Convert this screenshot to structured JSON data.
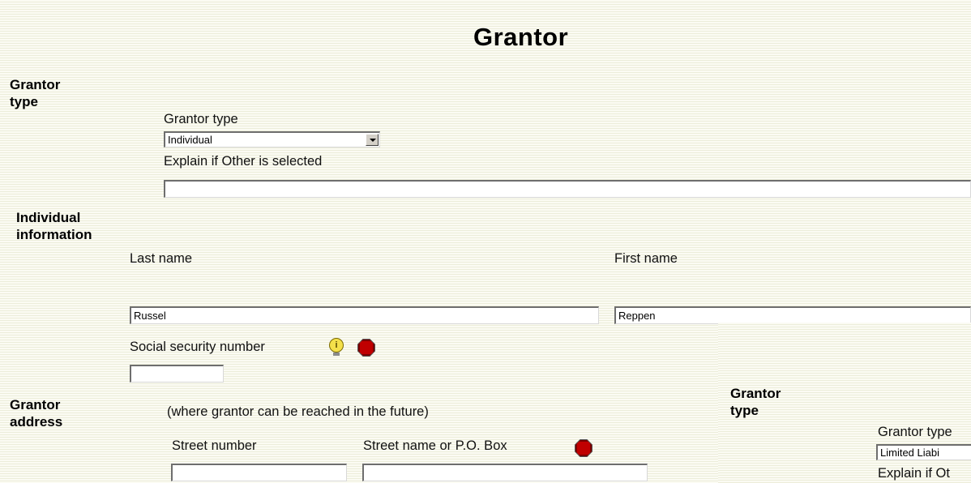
{
  "page": {
    "title": "Grantor"
  },
  "grantor_type_section": {
    "heading_line1": "Grantor",
    "heading_line2": "type",
    "type_label": "Grantor type",
    "type_value": "Individual",
    "explain_label": "Explain if Other is selected",
    "explain_value": ""
  },
  "individual_section": {
    "heading_line1": "Individual",
    "heading_line2": "information",
    "last_name_label": "Last name",
    "last_name_value": "Russel",
    "first_name_label": "First name",
    "first_name_value": "Reppen",
    "ssn_label": "Social security number",
    "ssn_value": "",
    "info_icon": "lightbulb-info-icon",
    "required_icon": "stop-sign-icon"
  },
  "address_section": {
    "heading_line1": "Grantor",
    "heading_line2": "address",
    "note": "(where grantor can be reached in the future)",
    "street_number_label": "Street number",
    "street_number_value": "",
    "street_name_label": "Street name or P.O. Box",
    "street_name_value": "",
    "required_icon": "stop-sign-icon"
  },
  "overlay_window": {
    "heading_line1": "Grantor",
    "heading_line2": "type",
    "type_label": "Grantor type",
    "type_value": "Limited Liabi",
    "explain_label": "Explain if Ot"
  },
  "colors": {
    "background": "#f6f6e9",
    "stripe": "#ecedda",
    "required": "#c00000",
    "info": "#f4e04a"
  }
}
